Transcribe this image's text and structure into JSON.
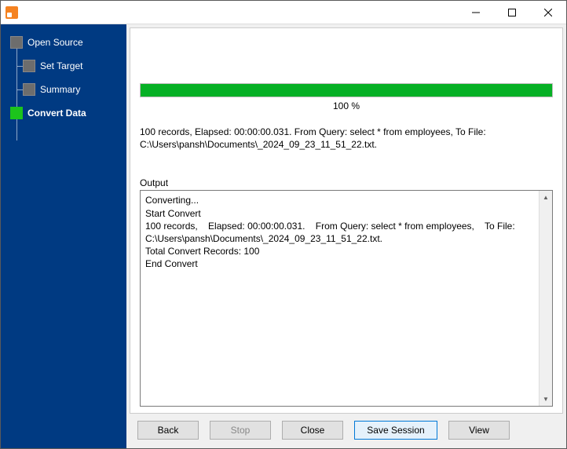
{
  "window": {
    "title": ""
  },
  "sidebar": {
    "items": [
      {
        "label": "Open Source",
        "active": false,
        "current": false
      },
      {
        "label": "Set Target",
        "active": false,
        "current": false
      },
      {
        "label": "Summary",
        "active": false,
        "current": false
      },
      {
        "label": "Convert Data",
        "active": true,
        "current": true
      }
    ]
  },
  "progress": {
    "percent": 100,
    "label": "100 %"
  },
  "status_text": "100 records,    Elapsed: 00:00:00.031.    From Query: select * from employees,    To File: C:\\Users\\pansh\\Documents\\_2024_09_23_11_51_22.txt.",
  "output": {
    "label": "Output",
    "text": "Converting...\nStart Convert\n100 records,    Elapsed: 00:00:00.031.    From Query: select * from employees,    To File: C:\\Users\\pansh\\Documents\\_2024_09_23_11_51_22.txt.\nTotal Convert Records: 100\nEnd Convert"
  },
  "buttons": {
    "back": "Back",
    "stop": "Stop",
    "close": "Close",
    "save_session": "Save Session",
    "view": "View"
  }
}
